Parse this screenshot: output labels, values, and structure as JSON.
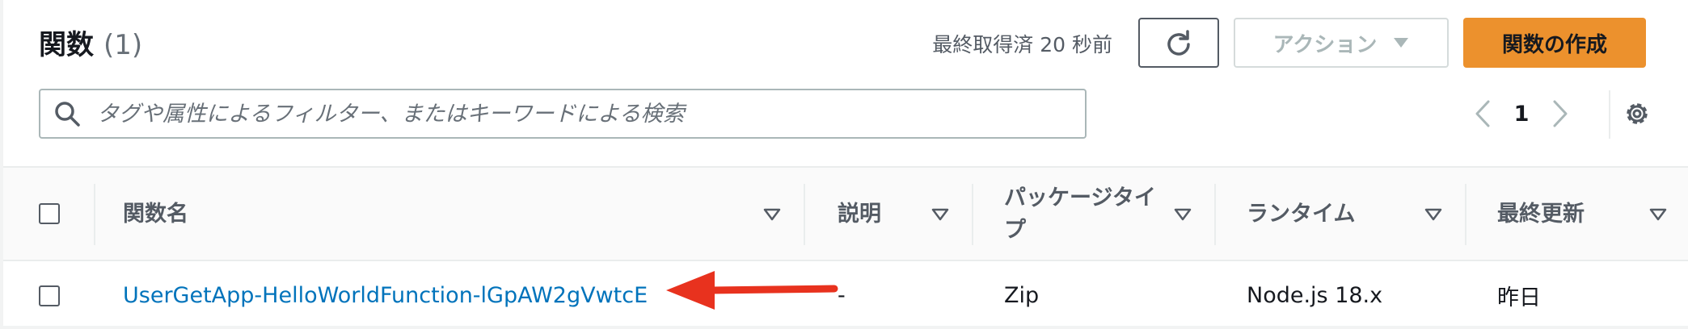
{
  "header": {
    "title": "関数",
    "count": "(1)",
    "last_fetched": "最終取得済 20 秒前",
    "action_label": "アクション",
    "create_label": "関数の作成"
  },
  "search": {
    "placeholder": "タグや属性によるフィルター、またはキーワードによる検索",
    "value": ""
  },
  "pagination": {
    "current_page": "1"
  },
  "table": {
    "columns": [
      "関数名",
      "説明",
      "パッケージタイプ",
      "ランタイム",
      "最終更新"
    ],
    "rows": [
      {
        "name": "UserGetApp-HelloWorldFunction-lGpAW2gVwtcE",
        "description": "-",
        "package_type": "Zip",
        "runtime": "Node.js 18.x",
        "last_modified": "昨日"
      }
    ]
  },
  "colors": {
    "accent": "#ec912d",
    "link": "#0073bb",
    "annotation_arrow": "#e8321e"
  },
  "icons": [
    "refresh-icon",
    "caret-down-icon",
    "search-icon",
    "chevron-left-icon",
    "chevron-right-icon",
    "settings-gear-icon",
    "sort-icon"
  ]
}
